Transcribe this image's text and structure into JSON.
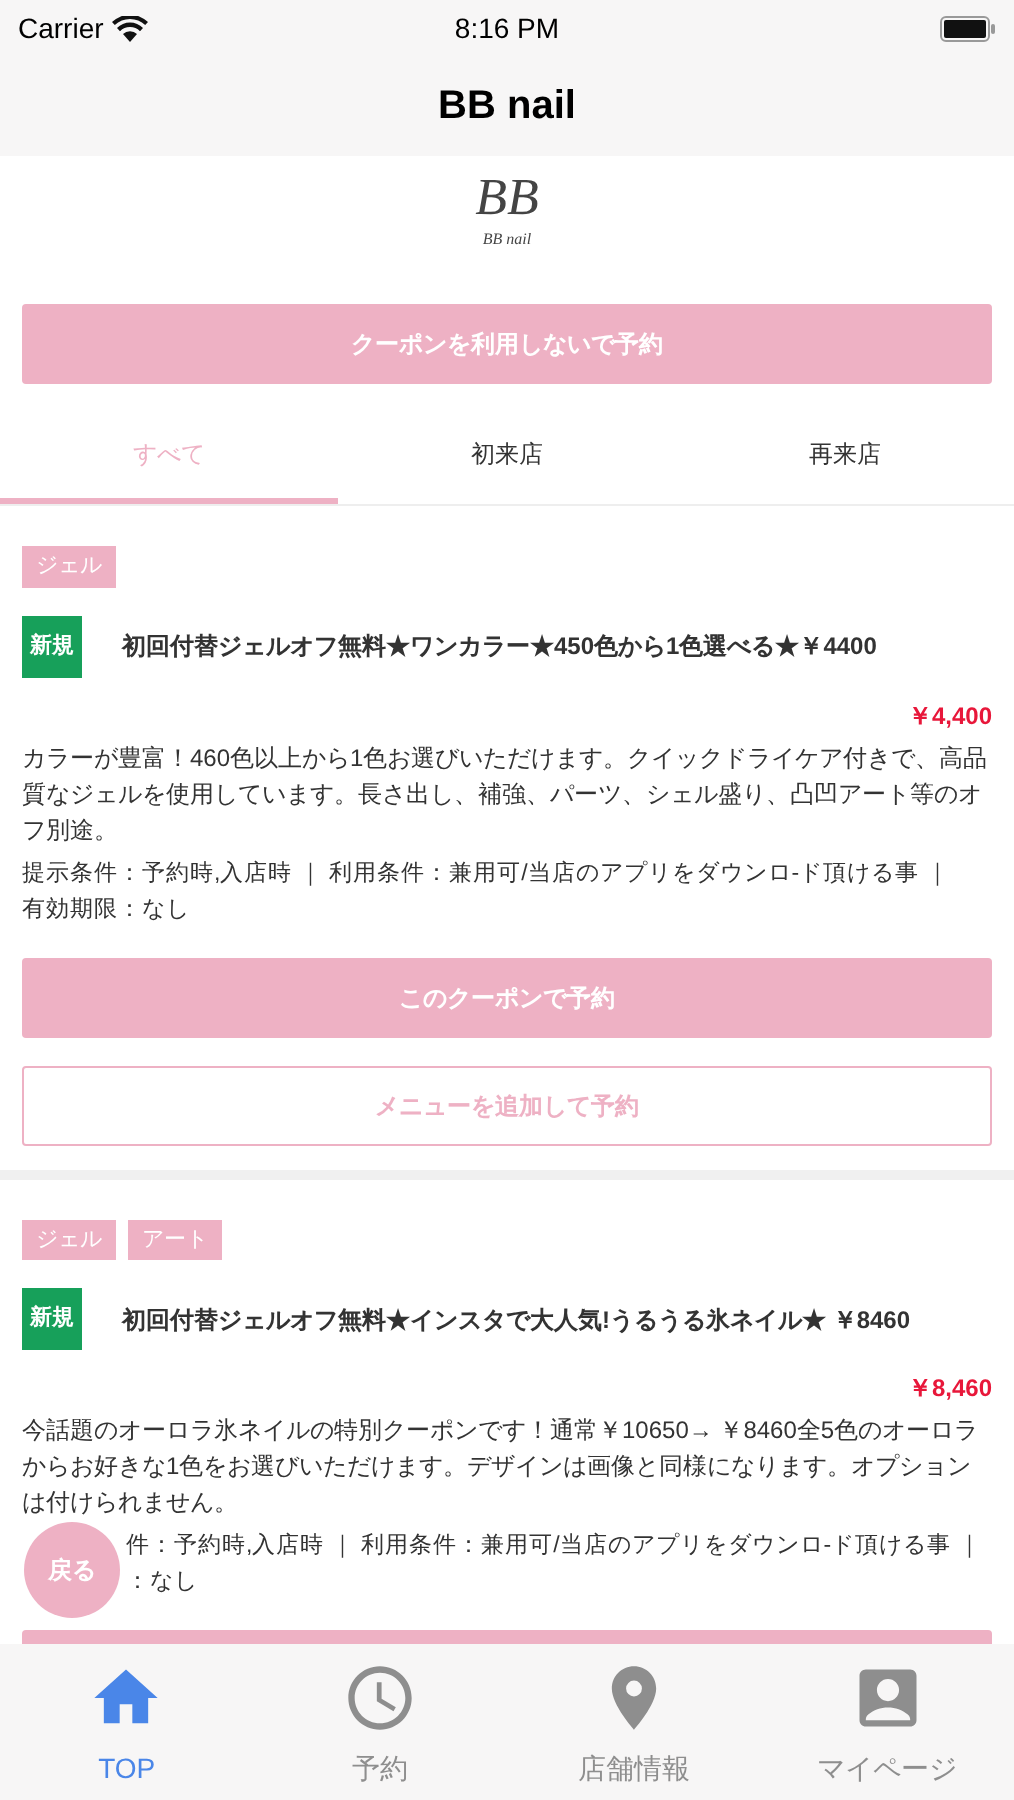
{
  "status_bar": {
    "carrier": "Carrier",
    "time": "8:16 PM"
  },
  "nav": {
    "title": "BB nail"
  },
  "logo": {
    "monogram": "BB",
    "name": "BB nail"
  },
  "top_button": "クーポンを利用しないで予約",
  "tabs": [
    {
      "label": "すべて",
      "selected": true
    },
    {
      "label": "初来店",
      "selected": false
    },
    {
      "label": "再来店",
      "selected": false
    }
  ],
  "coupons": [
    {
      "tags": [
        "ジェル"
      ],
      "badge": "新規",
      "title": "初回付替ジェルオフ無料★ワンカラー★450色から1色選べる★￥4400",
      "price": "￥4,400",
      "description": "カラーが豊富！460色以上から1色お選びいただけます。クイックドライケア付きで、高品質なジェルを使用しています。長さ出し、補強、パーツ、シェル盛り、凸凹アート等のオフ別途。",
      "conditions": [
        "提示条件：予約時,入店時 ｜ 利用条件：兼用可/当店のアプリをダウンロ-ド頂ける事 ｜",
        "有効期限：なし"
      ],
      "covered_by_back_button": false,
      "buttons": [
        {
          "kind": "primary",
          "label": "このクーポンで予約"
        },
        {
          "kind": "outline",
          "label": "メニューを追加して予約"
        }
      ]
    },
    {
      "tags": [
        "ジェル",
        "アート"
      ],
      "badge": "新規",
      "title": "初回付替ジェルオフ無料★インスタで大人気!うるうる氷ネイル★ ￥8460",
      "price": "￥8,460",
      "description": "今話題のオーロラ氷ネイルの特別クーポンです！通常￥10650→ ￥8460全5色のオーロラからお好きな1色をお選びいただけます。デザインは画像と同様になります。オプションは付けられません。",
      "conditions": [
        "件：予約時,入店時 ｜ 利用条件：兼用可/当店のアプリをダウンロ-ド頂ける事 ｜",
        "：なし"
      ],
      "covered_by_back_button": true,
      "buttons": [
        {
          "kind": "primary"
        }
      ]
    }
  ],
  "back_button": "戻る",
  "tab_bar": [
    {
      "kind": "home",
      "label": "TOP",
      "selected": true
    },
    {
      "kind": "clock",
      "label": "予約",
      "selected": false
    },
    {
      "kind": "pin",
      "label": "店舗情報",
      "selected": false
    },
    {
      "kind": "person",
      "label": "マイページ",
      "selected": false
    }
  ]
}
